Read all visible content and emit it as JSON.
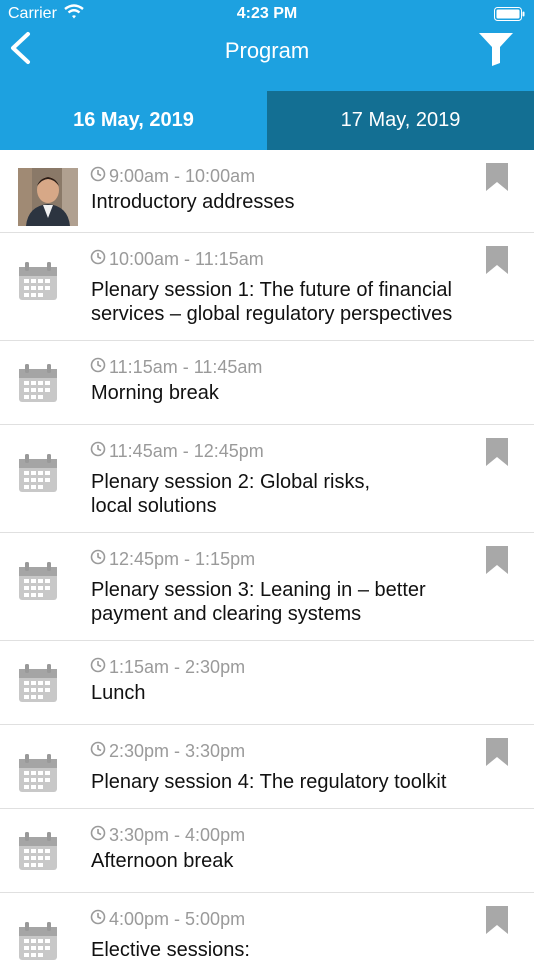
{
  "status": {
    "carrier": "Carrier",
    "time": "4:23 PM"
  },
  "nav": {
    "title": "Program"
  },
  "tabs": [
    {
      "label": "16 May, 2019",
      "active": true
    },
    {
      "label": "17 May, 2019",
      "active": false
    }
  ],
  "items": [
    {
      "time": "9:00am - 10:00am",
      "title": "Introductory addresses",
      "icon": "avatar",
      "bookmark": true
    },
    {
      "time": "10:00am - 11:15am",
      "title": "Plenary session 1: The future of financial services – global regulatory perspectives",
      "icon": "calendar-icon",
      "bookmark": true
    },
    {
      "time": "11:15am - 11:45am",
      "title": "Morning break",
      "icon": "calendar-icon",
      "bookmark": false
    },
    {
      "time": "11:45am - 12:45pm",
      "title": "Plenary session 2: Global risks, local solutions",
      "icon": "calendar-icon",
      "bookmark": true
    },
    {
      "time": "12:45pm - 1:15pm",
      "title": "Plenary session 3: Leaning in – better payment and clearing systems",
      "icon": "calendar-icon",
      "bookmark": true
    },
    {
      "time": "1:15am - 2:30pm",
      "title": "Lunch",
      "icon": "calendar-icon",
      "bookmark": false
    },
    {
      "time": "2:30pm - 3:30pm",
      "title": "Plenary session 4: The regulatory toolkit",
      "icon": "calendar-icon",
      "bookmark": true
    },
    {
      "time": "3:30pm - 4:00pm",
      "title": "Afternoon break",
      "icon": "calendar-icon",
      "bookmark": false
    },
    {
      "time": "4:00pm - 5:00pm",
      "title": "Elective sessions:",
      "icon": "calendar-icon",
      "bookmark": true
    }
  ]
}
